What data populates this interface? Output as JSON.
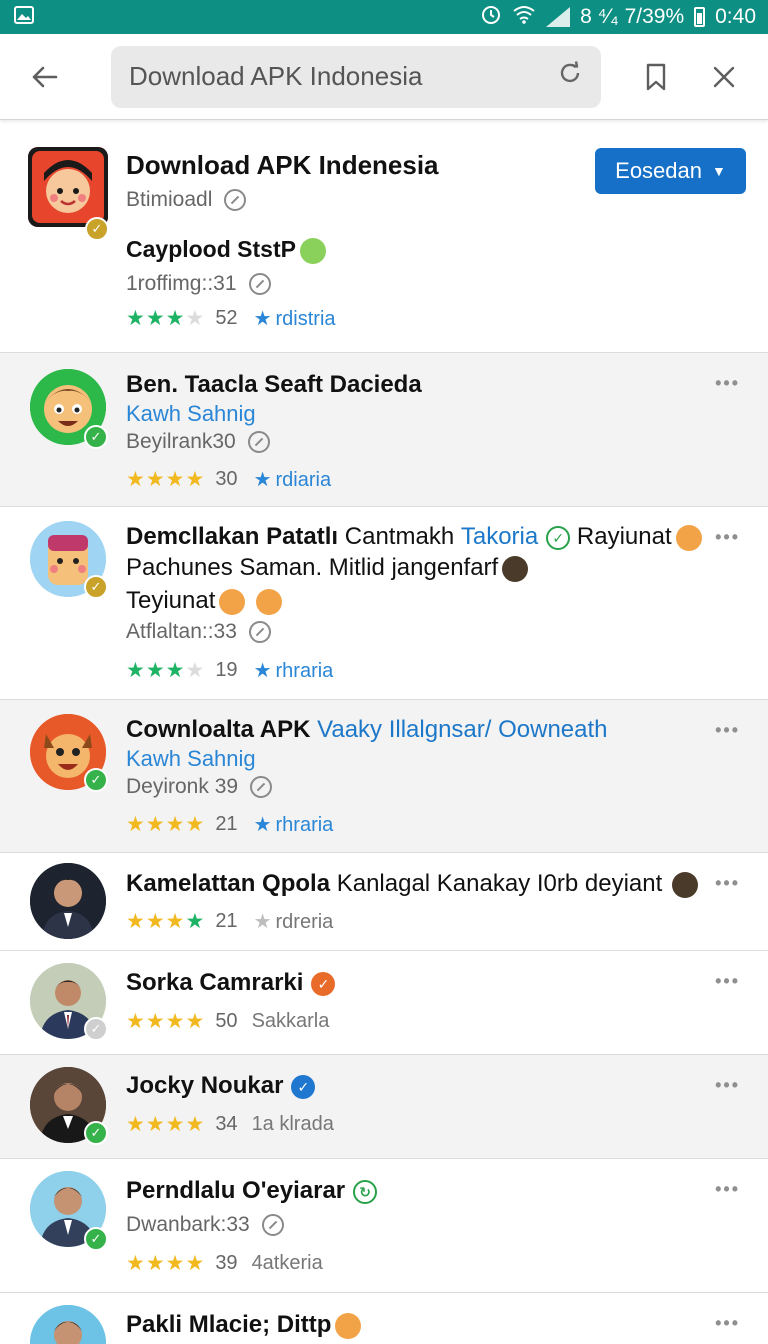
{
  "status_bar": {
    "left_icon": "image-icon",
    "right_text": "8 ⁴⁄₄ 7/39%",
    "time": "0:40"
  },
  "header": {
    "search_text": "Download APK Indonesia"
  },
  "items": [
    {
      "title": "Download APK Indenesia",
      "subtitle": "Btimioadl",
      "line2": "Cayplood StstP",
      "line3": "1roffimg::31",
      "rating_count": "52",
      "tag": "rdistria",
      "button": "Eosedan",
      "stars": 3
    },
    {
      "title": "Ben. Taacla Seaft Dacieda",
      "subtitle_blue": "Kawh Sahnig",
      "subtitle_grey": "Beyilrank30",
      "rating_count": "30",
      "tag": "rdiaria",
      "stars": 4
    },
    {
      "title_bold": "Demcllakan Patatlı",
      "title_plain": "Cantmakh",
      "title_link": "Takoria",
      "title_tail": "Rayiunat",
      "line2": "Pachunes Saman. Mitlid jangenfarf",
      "line3": "Teyiunat",
      "subtitle_grey": "Atflaltan::33",
      "rating_count": "19",
      "tag": "rhraria",
      "stars": 3
    },
    {
      "title_bold": "Cownloalta APK",
      "title_link": "Vaaky Illalgnsar/ Oowneath",
      "subtitle_blue": "Kawh Sahnig",
      "subtitle_grey": "Deyironk 39",
      "rating_count": "21",
      "tag": "rhraria",
      "stars": 4
    },
    {
      "title_bold": "Kamelattan Qpola",
      "title_plain": "Kanlagal Kanakay I0rb deyiant",
      "rating_count": "21",
      "tag": "rdreria",
      "stars": 4
    },
    {
      "title": "Sorka Camrarki",
      "rating_count": "50",
      "tag": "Sakkarla",
      "stars": 4
    },
    {
      "title": "Jocky Noukar",
      "rating_count": "34",
      "tag": "1a klrada",
      "stars": 4
    },
    {
      "title": "Perndlalu O'eyiarar",
      "subtitle_grey": "Dwanbark:33",
      "rating_count": "39",
      "tag": "4atkeria",
      "stars": 4
    },
    {
      "title": "Pakli Mlacie; Dittp"
    }
  ],
  "more_label": "•••",
  "star_char": "★",
  "colors": {
    "status_bar": "#0e8f83",
    "accent_blue": "#1670c8",
    "link_blue": "#2a86d6",
    "star_green": "#1db364",
    "star_gold": "#f2b81f"
  }
}
